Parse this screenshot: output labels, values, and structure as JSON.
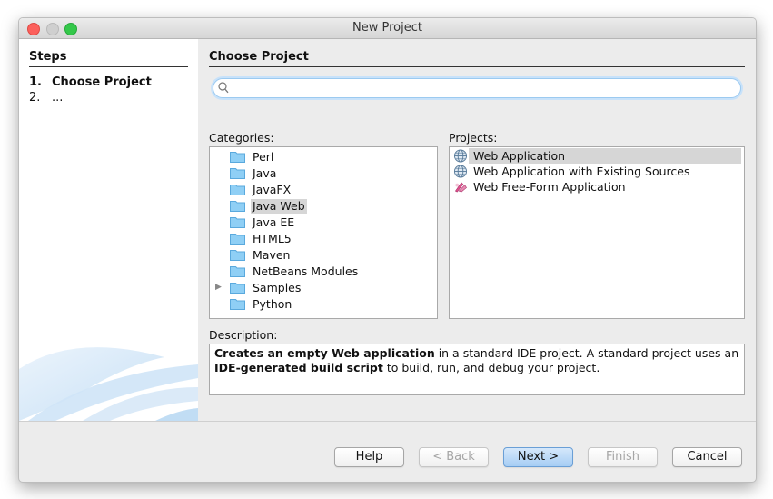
{
  "window": {
    "title": "New Project"
  },
  "steps": {
    "header": "Steps",
    "items": [
      {
        "number": "1.",
        "label": "Choose Project"
      },
      {
        "number": "2.",
        "label": "..."
      }
    ]
  },
  "main": {
    "header": "Choose Project",
    "search": {
      "value": "",
      "placeholder": ""
    },
    "categories_label": "Categories:",
    "categories": [
      {
        "label": "Perl",
        "icon": "folder-icon"
      },
      {
        "label": "Java",
        "icon": "folder-icon"
      },
      {
        "label": "JavaFX",
        "icon": "folder-icon"
      },
      {
        "label": "Java Web",
        "icon": "folder-icon",
        "selected": true
      },
      {
        "label": "Java EE",
        "icon": "folder-icon"
      },
      {
        "label": "HTML5",
        "icon": "folder-icon"
      },
      {
        "label": "Maven",
        "icon": "folder-icon"
      },
      {
        "label": "NetBeans Modules",
        "icon": "folder-icon"
      },
      {
        "label": "Samples",
        "icon": "folder-icon",
        "expandable": true
      },
      {
        "label": "Python",
        "icon": "folder-icon"
      }
    ],
    "projects_label": "Projects:",
    "projects": [
      {
        "label": "Web Application",
        "icon": "globe-icon",
        "selected": true
      },
      {
        "label": "Web Application with Existing Sources",
        "icon": "globe-icon"
      },
      {
        "label": "Web Free-Form Application",
        "icon": "freeform-app-icon"
      }
    ],
    "description_label": "Description:",
    "description": {
      "bold1": "Creates an empty Web application",
      "text1": " in a standard IDE project. A standard project uses an ",
      "bold2": "IDE-generated build script",
      "text2": " to build, run, and debug your project."
    }
  },
  "buttons": {
    "help": "Help",
    "back": "< Back",
    "next": "Next >",
    "finish": "Finish",
    "cancel": "Cancel"
  },
  "colors": {
    "accent": "#a6cdf4",
    "selection": "#d6d6d6",
    "folder": "#8fcff5",
    "close": "#fc605c",
    "maximize": "#34c84a"
  }
}
